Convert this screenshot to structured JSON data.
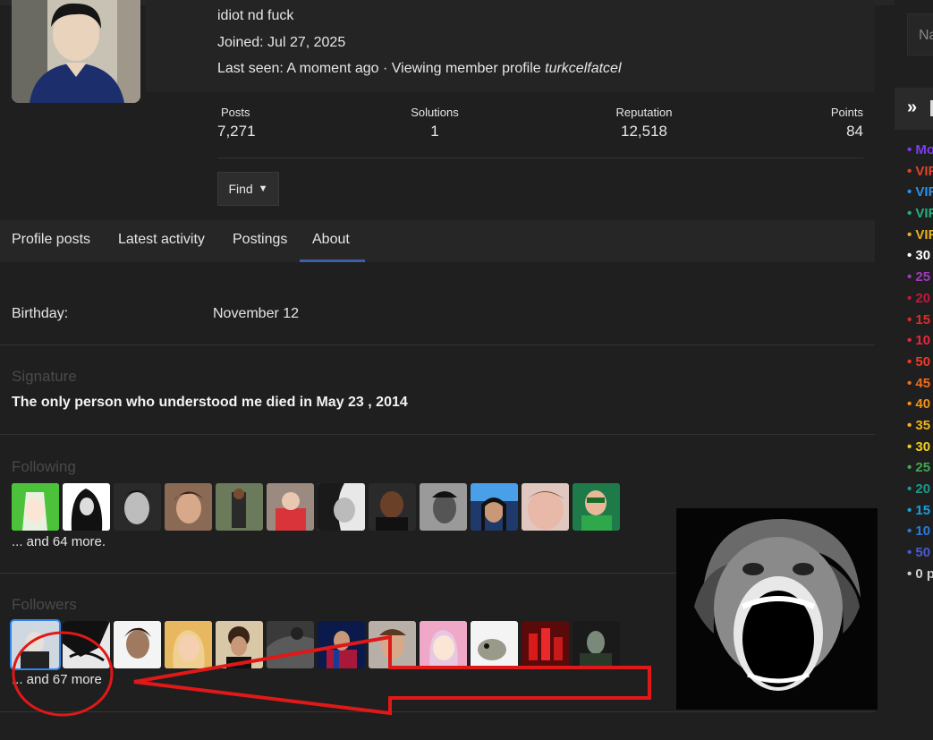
{
  "profile": {
    "status_text": "idiot nd fuck",
    "joined": "Joined: Jul 27, 2025",
    "last_seen_prefix": "Last seen: A moment ago · Viewing member profile ",
    "last_seen_name": "turkcelfatcel"
  },
  "stats": [
    {
      "label": "Posts",
      "value": "7,271"
    },
    {
      "label": "Solutions",
      "value": "1"
    },
    {
      "label": "Reputation",
      "value": "12,518"
    },
    {
      "label": "Points",
      "value": "84"
    }
  ],
  "find_label": "Find",
  "tabs": [
    "Profile posts",
    "Latest activity",
    "Postings",
    "About"
  ],
  "active_tab": "About",
  "about": {
    "birthday_label": "Birthday:",
    "birthday_value": "November 12",
    "signature_title": "Signature",
    "signature_text": "The only person who understood me died in May 23 , 2014",
    "following_title": "Following",
    "following_more": "... and 64 more.",
    "followers_title": "Followers",
    "followers_more": "... and 67 more"
  },
  "sidebar": {
    "input_placeholder": "Na",
    "items": [
      {
        "text": "• Mo",
        "color": "#7a3cf0"
      },
      {
        "text": "• VIF",
        "color": "#e0442a"
      },
      {
        "text": "• VIF",
        "color": "#2a8fe8"
      },
      {
        "text": "• VIF",
        "color": "#25b07c"
      },
      {
        "text": "• VIF",
        "color": "#e8b020"
      },
      {
        "text": "• 30",
        "color": "#ffffff"
      },
      {
        "text": "• 25",
        "color": "#a03ab8"
      },
      {
        "text": "• 20",
        "color": "#c2183a"
      },
      {
        "text": "• 15",
        "color": "#e02a2a"
      },
      {
        "text": "• 10",
        "color": "#e8283c"
      },
      {
        "text": "• 50",
        "color": "#ee3a2a"
      },
      {
        "text": "• 45",
        "color": "#f06a1a"
      },
      {
        "text": "• 40",
        "color": "#f0901a"
      },
      {
        "text": "• 35",
        "color": "#f0b41a"
      },
      {
        "text": "• 30",
        "color": "#f0d01a"
      },
      {
        "text": "• 25",
        "color": "#3ea852"
      },
      {
        "text": "• 20",
        "color": "#1a9a8a"
      },
      {
        "text": "• 15",
        "color": "#1aa0d8"
      },
      {
        "text": "• 10",
        "color": "#2a7ae0"
      },
      {
        "text": "• 50",
        "color": "#4a5ad0"
      },
      {
        "text": "• 0 p",
        "color": "#cfcfcf"
      }
    ]
  },
  "colors": {
    "background": "#1f1f1f",
    "panel": "#262626",
    "tab_accent": "#3b5fa8",
    "annotation": "#e01818"
  }
}
